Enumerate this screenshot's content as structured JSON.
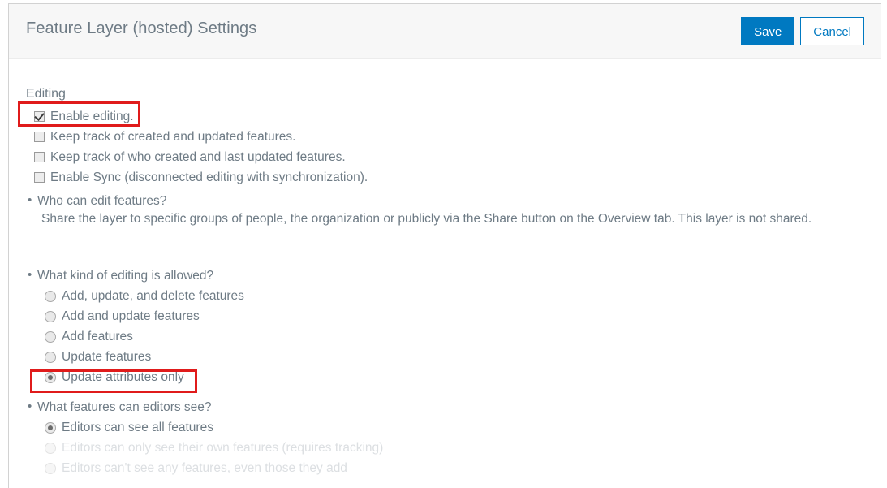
{
  "window": {
    "title": "Feature Layer (hosted) Settings"
  },
  "toolbar": {
    "save_label": "Save",
    "cancel_label": "Cancel"
  },
  "editing": {
    "heading": "Editing",
    "checkboxes": [
      {
        "label": "Enable editing.",
        "checked": true,
        "highlighted": true
      },
      {
        "label": "Keep track of created and updated features.",
        "checked": false,
        "highlighted": false
      },
      {
        "label": "Keep track of who created and last updated features.",
        "checked": false,
        "highlighted": false
      },
      {
        "label": "Enable Sync (disconnected editing with synchronization).",
        "checked": false,
        "highlighted": false
      }
    ]
  },
  "who_can_edit": {
    "question": "Who can edit features?",
    "body": "Share the layer to specific groups of people, the organization or publicly via the Share button on the Overview tab. This layer is not shared."
  },
  "kind_of_editing": {
    "question": "What kind of editing is allowed?",
    "options": [
      {
        "label": "Add, update, and delete features",
        "selected": false,
        "disabled": false,
        "highlighted": false
      },
      {
        "label": "Add and update features",
        "selected": false,
        "disabled": false,
        "highlighted": false
      },
      {
        "label": "Add features",
        "selected": false,
        "disabled": false,
        "highlighted": false
      },
      {
        "label": "Update features",
        "selected": false,
        "disabled": false,
        "highlighted": false
      },
      {
        "label": "Update attributes only",
        "selected": true,
        "disabled": false,
        "highlighted": true
      }
    ]
  },
  "editors_can_see": {
    "question": "What features can editors see?",
    "options": [
      {
        "label": "Editors can see all features",
        "selected": true,
        "disabled": false,
        "highlighted": false
      },
      {
        "label": "Editors can only see their own features (requires tracking)",
        "selected": false,
        "disabled": true,
        "highlighted": false
      },
      {
        "label": "Editors can't see any features, even those they add",
        "selected": false,
        "disabled": true,
        "highlighted": false
      }
    ]
  },
  "colors": {
    "accent": "#0079c1",
    "text": "#6e7b85",
    "highlight": "#e01b1b",
    "header_bg": "#f7f7f7"
  }
}
